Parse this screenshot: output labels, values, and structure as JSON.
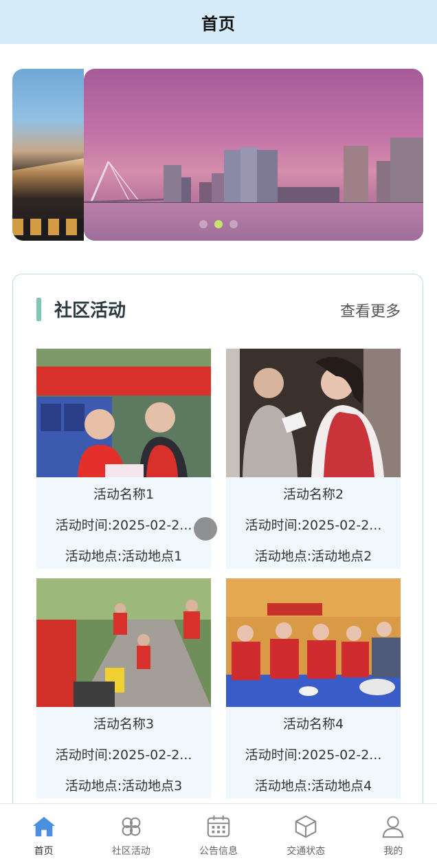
{
  "header": {
    "title": "首页"
  },
  "banner": {
    "slide_count": 3,
    "active_index": 1
  },
  "section": {
    "title": "社区活动",
    "more_label": "查看更多"
  },
  "activities": [
    {
      "name": "活动名称1",
      "time": "活动时间:2025-02-2...",
      "place": "活动地点:活动地点1"
    },
    {
      "name": "活动名称2",
      "time": "活动时间:2025-02-2...",
      "place": "活动地点:活动地点2"
    },
    {
      "name": "活动名称3",
      "time": "活动时间:2025-02-2...",
      "place": "活动地点:活动地点3"
    },
    {
      "name": "活动名称4",
      "time": "活动时间:2025-02-2...",
      "place": "活动地点:活动地点4"
    }
  ],
  "tabbar": {
    "items": [
      {
        "label": "首页",
        "icon": "home-icon",
        "active": true
      },
      {
        "label": "社区活动",
        "icon": "clover-icon",
        "active": false
      },
      {
        "label": "公告信息",
        "icon": "calendar-icon",
        "active": false
      },
      {
        "label": "交通状态",
        "icon": "cube-icon",
        "active": false
      },
      {
        "label": "我的",
        "icon": "user-icon",
        "active": false
      }
    ]
  },
  "colors": {
    "header_bg": "#d6ecfb",
    "accent": "#7ec7b4",
    "tab_active": "#4a8fe0",
    "tab_inactive": "#8a8a8a",
    "card_bg": "#f1f8fd"
  }
}
